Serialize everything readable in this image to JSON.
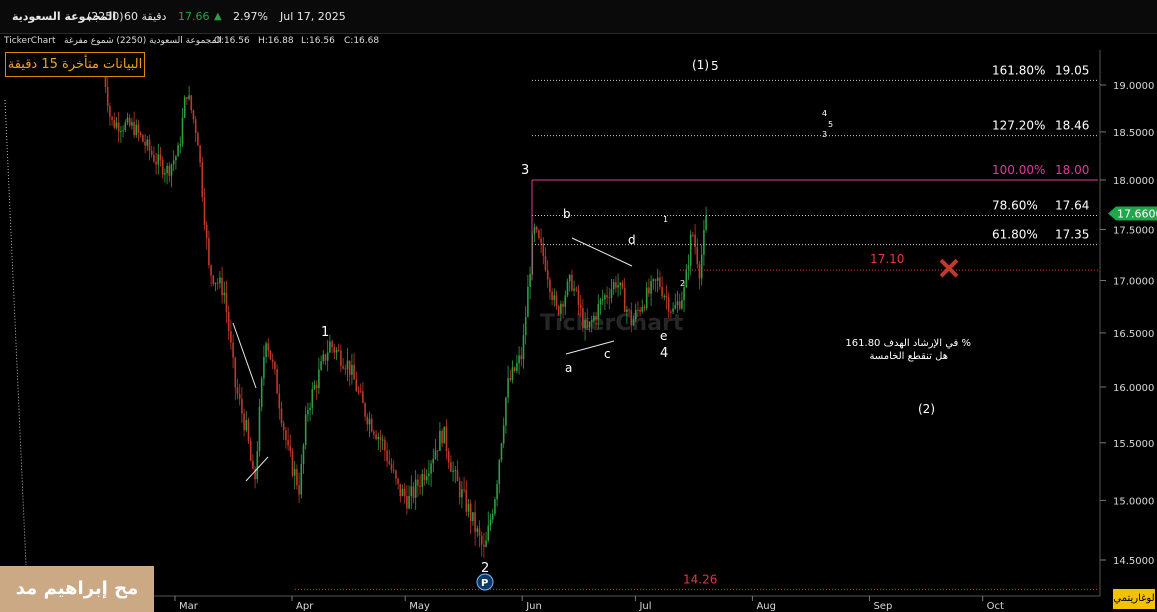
{
  "header": {
    "name": "المجموعة السعودية",
    "code": "(2250)",
    "interval": "60 دقيقة",
    "price": "17.66",
    "change_pct": "2.97%",
    "date": "Jul 17, 2025"
  },
  "subheader": {
    "brand": "TickerChart",
    "series": "المجموعة السعودية (2250) شموع مفرغة",
    "open": "O:16.56",
    "high": "H:16.88",
    "low": "L:16.56",
    "close": "C:16.68"
  },
  "delay_notice": "البيانات متأخرة 15 دقيقة",
  "author_watermark": "مح إبراهيم مد",
  "chart_watermark": "TickerChart",
  "scale_toggle": "لوغاريتمي",
  "last_price_label": "17.6600",
  "colors": {
    "up": "#2ea043",
    "down": "#c0392b",
    "pink": "#e0399a",
    "red_text": "#e0393b",
    "green_tag": "#1ea84a"
  },
  "chart_data": {
    "type": "candlestick",
    "ylim": [
      14.2,
      19.3
    ],
    "y_ticks": [
      "19.0000",
      "18.5000",
      "18.0000",
      "17.5000",
      "17.0000",
      "16.5000",
      "16.0000",
      "15.5000",
      "15.0000",
      "14.5000"
    ],
    "x_ticks": [
      "Mar",
      "Apr",
      "May",
      "Jun",
      "Jul",
      "Aug",
      "Sep",
      "Oct"
    ],
    "fib_levels": [
      {
        "pct": "161.80%",
        "price": "19.05",
        "value": 19.05
      },
      {
        "pct": "127.20%",
        "price": "18.46",
        "value": 18.46
      },
      {
        "pct": "100.00%",
        "price": "18.00",
        "value": 18.0
      },
      {
        "pct": "78.60%",
        "price": "17.64",
        "value": 17.64
      },
      {
        "pct": "61.80%",
        "price": "17.35",
        "value": 17.35
      }
    ],
    "level_1710": {
      "label": "17.10",
      "value": 17.1
    },
    "level_1426": {
      "label": "14.26",
      "value": 14.26
    },
    "last_price": 17.66,
    "price_path": [
      [
        "Feb 10",
        19.2
      ],
      [
        "Feb 12",
        18.6
      ],
      [
        "Feb 18",
        18.55
      ],
      [
        "Feb 24",
        18.2
      ],
      [
        "Feb 27",
        18.1
      ],
      [
        "Mar 2",
        18.3
      ],
      [
        "Mar 4",
        18.95
      ],
      [
        "Mar 7",
        18.45
      ],
      [
        "Mar 10",
        17.1
      ],
      [
        "Mar 14",
        16.9
      ],
      [
        "Mar 17",
        16.0
      ],
      [
        "Mar 20",
        15.6
      ],
      [
        "Mar 22",
        15.1
      ],
      [
        "Mar 25",
        16.5
      ],
      [
        "Mar 28",
        16.0
      ],
      [
        "Mar 31",
        15.4
      ],
      [
        "Apr 3",
        15.1
      ],
      [
        "Apr 5",
        15.8
      ],
      [
        "Apr 8",
        16.1
      ],
      [
        "Apr 11",
        16.4
      ],
      [
        "Apr 16",
        16.2
      ],
      [
        "Apr 20",
        15.8
      ],
      [
        "Apr 25",
        15.5
      ],
      [
        "Apr 29",
        15.1
      ],
      [
        "May 2",
        15.0
      ],
      [
        "May 7",
        15.3
      ],
      [
        "May 11",
        15.6
      ],
      [
        "May 14",
        15.2
      ],
      [
        "May 18",
        14.9
      ],
      [
        "May 22",
        14.55
      ],
      [
        "May 25",
        15.1
      ],
      [
        "May 28",
        16.0
      ],
      [
        "Jun 1",
        16.3
      ],
      [
        "Jun 4",
        17.5
      ],
      [
        "Jun 7",
        17.2
      ],
      [
        "Jun 10",
        16.7
      ],
      [
        "Jun 14",
        17.0
      ],
      [
        "Jun 18",
        16.5
      ],
      [
        "Jun 22",
        16.8
      ],
      [
        "Jun 26",
        17.0
      ],
      [
        "Jun 30",
        16.6
      ],
      [
        "Jul 3",
        16.8
      ],
      [
        "Jul 7",
        17.0
      ],
      [
        "Jul 11",
        16.7
      ],
      [
        "Jul 14",
        16.9
      ],
      [
        "Jul 16",
        17.5
      ],
      [
        "Jul 18",
        17.1
      ],
      [
        "Jul 20",
        17.66
      ]
    ],
    "labels": {
      "w1": "1",
      "w2": "2",
      "w3": "3",
      "w4": "4",
      "w5_top": "5",
      "w5_1": "(1)",
      "a": "a",
      "b": "b",
      "c": "c",
      "d": "d",
      "e": "e",
      "w_2": "(2)",
      "sub1": "1",
      "sub2": "2",
      "sub3": "3",
      "sub4": "4",
      "sub5": "5",
      "pivot": "P"
    },
    "note_line1": "في الإرشاد الهدف 161.80 %",
    "note_line2": "هل تنقطع الخامسة"
  }
}
